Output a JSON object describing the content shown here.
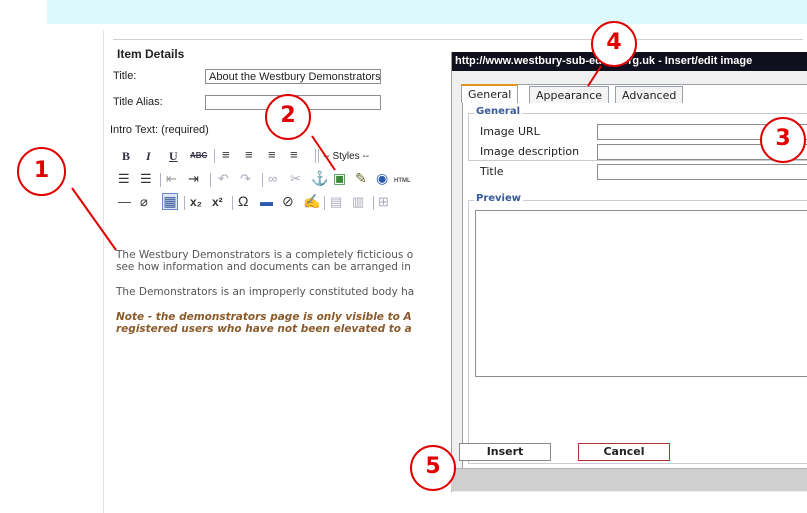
{
  "item_details": {
    "header": "Item Details",
    "title_label": "Title:",
    "title_value": "About the Westbury Demonstrators",
    "alias_label": "Title Alias:",
    "alias_value": "",
    "intro_label": "Intro Text: (required)"
  },
  "toolbar": {
    "bold": "B",
    "italic": "I",
    "underline": "U",
    "strike": "ABC",
    "styles": "-- Styles --",
    "html": "HTML"
  },
  "editor": {
    "line1": "The Westbury Demonstrators is a completely ficticious o",
    "line2": "see how information and documents can be arranged in",
    "line3": "The Demonstrators is an improperly constituted body ha",
    "line4": "Note - the demonstrators page is only visible to A",
    "line5": "registered users who have not been elevated to a"
  },
  "dialog": {
    "title": "http://www.westbury-sub-edinp.org.uk - Insert/edit image",
    "tabs": [
      "General",
      "Appearance",
      "Advanced"
    ],
    "general_legend": "General",
    "image_url_label": "Image URL",
    "image_description_label": "Image description",
    "title_label": "Title",
    "preview_legend": "Preview",
    "insert_label": "Insert",
    "cancel_label": "Cancel"
  },
  "callouts": [
    "1",
    "2",
    "3",
    "4",
    "5"
  ]
}
